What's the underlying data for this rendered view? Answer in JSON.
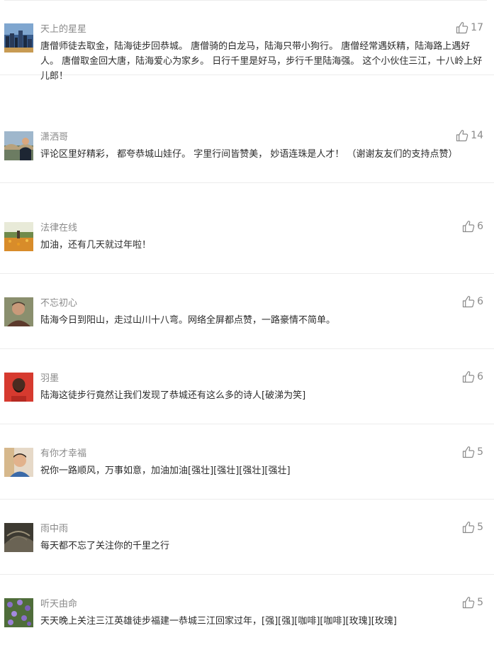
{
  "comments": [
    {
      "username": "天上的星星",
      "text": "唐僧师徒去取金，陆海徒步回恭城。 唐僧骑的白龙马，陆海只带小狗行。 唐僧经常遇妖精，陆海路上遇好人。 唐僧取金回大唐，陆海爱心为家乡。 日行千里是好马，步行千里陆海强。 这个小伙住三江，十八岭上好儿郎！",
      "likes": "17",
      "avatar": "city-night-avatar-icon"
    },
    {
      "username": "潇洒哥",
      "text": "评论区里好精彩， 都夸恭城山娃仔。 字里行间皆赞美， 妙语连珠是人才！ （谢谢友友们的支持点赞）",
      "likes": "14",
      "avatar": "man-at-bridge-avatar-icon"
    },
    {
      "username": "法律在线",
      "text": "加油，还有几天就过年啦！",
      "likes": "6",
      "avatar": "flower-field-avatar-icon"
    },
    {
      "username": "不忘初心",
      "text": "陆海今日到阳山，走过山川十八弯。网络全屏都点赞，一路豪情不简单。",
      "likes": "6",
      "avatar": "man-portrait-avatar-icon"
    },
    {
      "username": "羽墨",
      "text": "陆海这徒步行竟然让我们发现了恭城还有这么多的诗人[破涕为笑]",
      "likes": "6",
      "avatar": "red-jersey-avatar-icon"
    },
    {
      "username": "有你才幸福",
      "text": "祝你一路顺风，万事如意，加油加油[强壮][强壮][强壮][强壮]",
      "likes": "5",
      "avatar": "boy-portrait-avatar-icon"
    },
    {
      "username": "雨中雨",
      "text": "每天都不忘了关注你的千里之行",
      "likes": "5",
      "avatar": "dark-abstract-avatar-icon"
    },
    {
      "username": "听天由命",
      "text": "天天晚上关注三江英雄徒步福建一恭城三江回家过年，[强][强][咖啡][咖啡][玫瑰][玫瑰]",
      "likes": "5",
      "avatar": "purple-flowers-avatar-icon"
    }
  ]
}
